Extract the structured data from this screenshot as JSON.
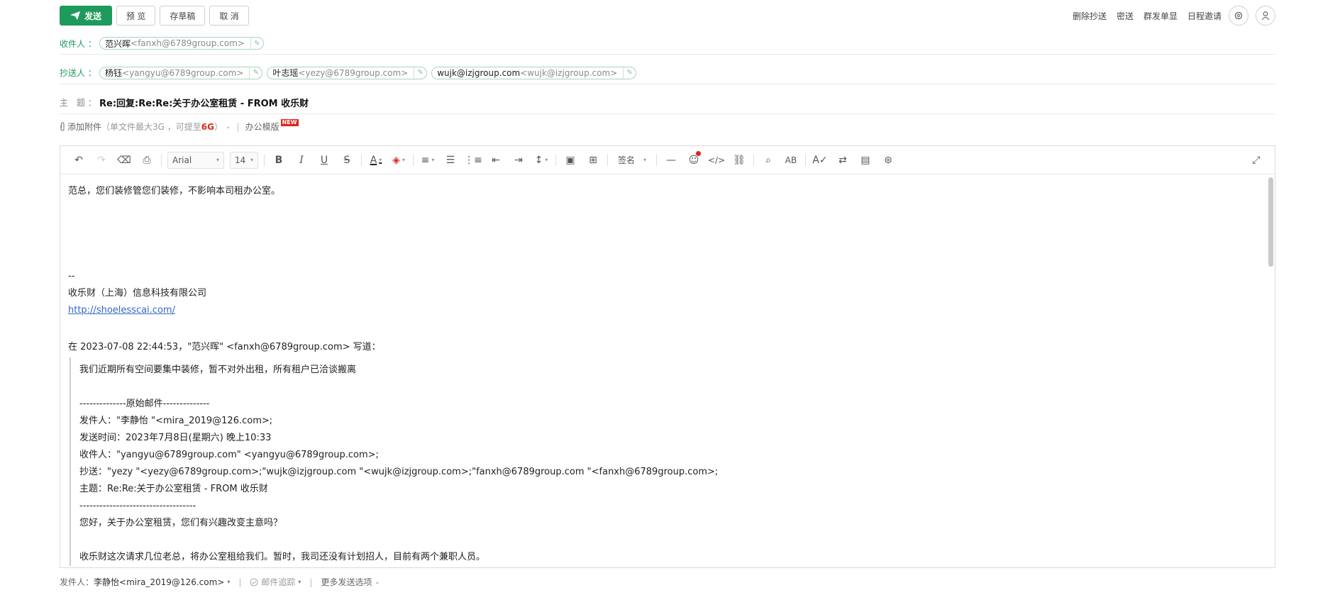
{
  "toolbar": {
    "send": "发送",
    "preview": "预 览",
    "draft": "存草稿",
    "cancel": "取 消",
    "remove_cc": "删除抄送",
    "bcc": "密送",
    "group_send": "群发单显",
    "schedule": "日程邀请"
  },
  "header": {
    "to_label": "收件人 ：",
    "to": [
      {
        "name": "范兴晖",
        "addr": "<fanxh@6789group.com>"
      }
    ],
    "cc_label": "抄送人 ：",
    "cc": [
      {
        "name": "杨钰",
        "addr": "<yangyu@6789group.com>"
      },
      {
        "name": "叶志瑶",
        "addr": "<yezy@6789group.com>"
      },
      {
        "name": "wujk@izjgroup.com",
        "addr": "<wujk@izjgroup.com>"
      }
    ],
    "subject_label": "主　题 ：",
    "subject": "Re:回复:Re:Re:关于办公室租赁 - FROM 收乐财"
  },
  "attach": {
    "add": "添加附件",
    "hint_a": "（单文件最大3G ，可提至",
    "hint_b": "6G",
    "hint_c": "）",
    "office_template": "办公模版",
    "new_badge": "NEW"
  },
  "editor_toolbar": {
    "font": "Arial",
    "size": "14",
    "signature": "签名"
  },
  "body": {
    "line1": "范总，您们装修管您们装修，不影响本司租办公室。",
    "sig_dash": "--",
    "sig_company": "收乐财（上海）信息科技有限公司",
    "sig_link": "http://shoelesscai.com/",
    "reply_header": "在 2023-07-08 22:44:53，\"范兴晖\" <fanxh@6789group.com> 写道：",
    "quote_lines": [
      "我们近期所有空间要集中装修，暂不对外出租，所有租户已洽谈搬离",
      "",
      "--------------原始邮件--------------",
      "发件人：\"李静怡 \"<mira_2019@126.com>;",
      "发送时间：2023年7月8日(星期六) 晚上10:33",
      "收件人：\"yangyu@6789group.com\" <yangyu@6789group.com>;",
      "抄送：\"yezy \"<yezy@6789group.com>;\"wujk@izjgroup.com \"<wujk@izjgroup.com>;\"fanxh@6789group.com \"<fanxh@6789group.com>;",
      "主题：Re:Re:关于办公室租赁 - FROM 收乐财",
      "-----------------------------------",
      "您好，关于办公室租赁，您们有兴趣改变主意吗？",
      "",
      "收乐财这次请求几位老总，将办公室租给我们。暂时，我司还没有计划招人，目前有两个兼职人员。"
    ]
  },
  "footer": {
    "sender_label": "发件人：",
    "sender": "李静怡<mira_2019@126.com>",
    "tracking": "邮件追踪",
    "more": "更多发送选项"
  },
  "colors": {
    "primary": "#1e9b5c",
    "link": "#3366cc",
    "alert": "#e0251f"
  }
}
